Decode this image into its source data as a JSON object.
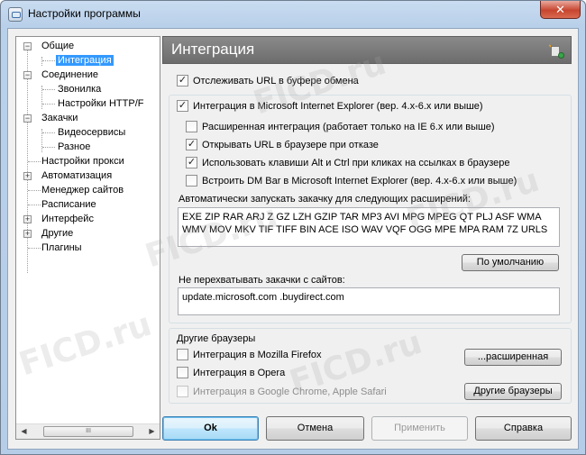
{
  "window": {
    "title": "Настройки программы",
    "close_label": "✕"
  },
  "tree": {
    "items": [
      {
        "label": "Общие"
      },
      {
        "label": "Интеграция",
        "selected": true
      },
      {
        "label": "Соединение"
      },
      {
        "label": "Звонилка"
      },
      {
        "label": "Настройки HTTP/F"
      },
      {
        "label": "Закачки"
      },
      {
        "label": "Видеосервисы"
      },
      {
        "label": "Разное"
      },
      {
        "label": "Настройки прокси"
      },
      {
        "label": "Автоматизация"
      },
      {
        "label": "Менеджер сайтов"
      },
      {
        "label": "Расписание"
      },
      {
        "label": "Интерфейс"
      },
      {
        "label": "Другие"
      },
      {
        "label": "Плагины"
      }
    ],
    "scroll_grip": "III"
  },
  "panel": {
    "title": "Интеграция",
    "clipboard": {
      "label": "Отслеживать URL в буфере обмена",
      "checked": true
    },
    "ie": {
      "label": "Интеграция в Microsoft Internet Explorer (вер. 4.x-6.x или выше)",
      "checked": true,
      "options": [
        {
          "label": "Расширенная интеграция (работает только на IE 6.x или выше)",
          "checked": false
        },
        {
          "label": "Открывать URL в браузере при отказе",
          "checked": true
        },
        {
          "label": "Использовать клавиши Alt и Ctrl при кликах на ссылках в браузере",
          "checked": true
        },
        {
          "label": "Встроить DM Bar в Microsoft Internet Explorer (вер. 4.x-6.x или выше)",
          "checked": false
        }
      ]
    },
    "extensions": {
      "label": "Автоматически запускать закачку для следующих расширений:",
      "value": "EXE ZIP RAR ARJ Z GZ LZH GZIP TAR MP3 AVI MPG MPEG QT PLJ ASF WMA WMV MOV MKV TIF TIFF BIN ACE ISO WAV VQF OGG MPE MPA RAM 7Z URLS",
      "default_button": "По умолчанию"
    },
    "exclude_sites": {
      "label": "Не перехватывать закачки с сайтов:",
      "value": "update.microsoft.com .buydirect.com"
    },
    "other_browsers": {
      "title": "Другие браузеры",
      "firefox": {
        "label": "Интеграция в Mozilla Firefox",
        "checked": false
      },
      "opera": {
        "label": "Интеграция в Opera",
        "checked": false
      },
      "chrome": {
        "label": "Интеграция в Google Chrome, Apple Safari",
        "checked": false,
        "disabled": true
      },
      "advanced_button": "...расширенная",
      "other_button": "Другие браузеры"
    }
  },
  "footer": {
    "ok": "Ok",
    "cancel": "Отмена",
    "apply": "Применить",
    "help": "Справка"
  },
  "watermark": "FICD.ru"
}
